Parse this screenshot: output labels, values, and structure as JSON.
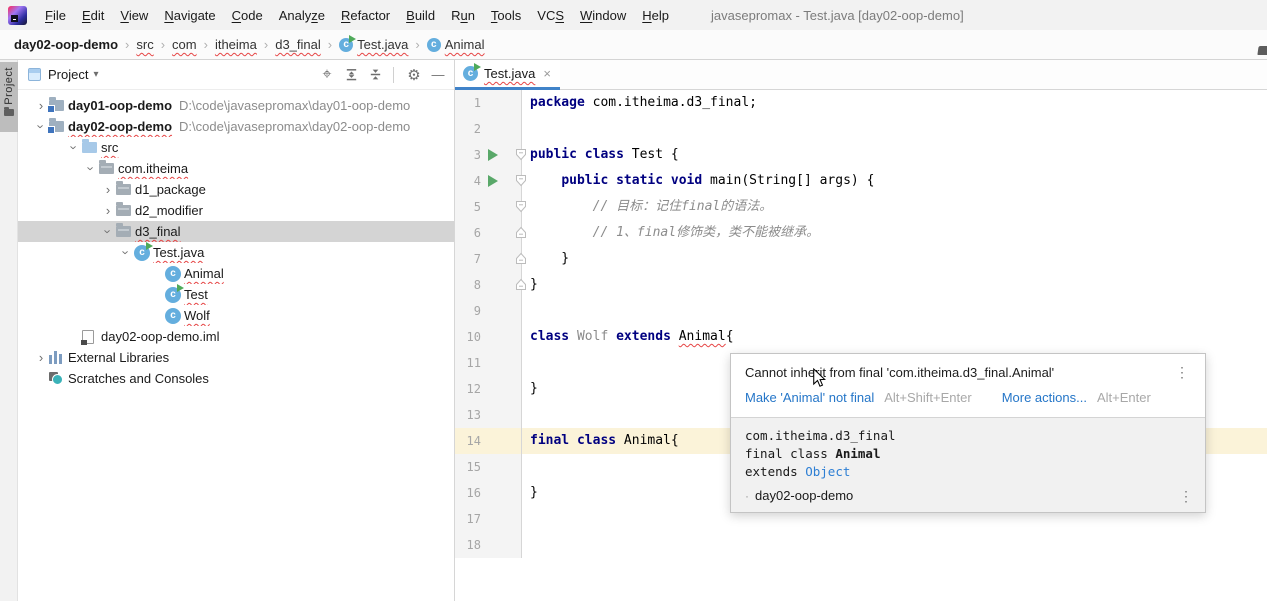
{
  "window": {
    "title": "javasepromax - Test.java [day02-oop-demo]"
  },
  "glyphs": {
    "chevron": "›",
    "caret": "▾",
    "close": "×",
    "kebab": "⋮",
    "sep": "›",
    "minus": "—",
    "dot": "·",
    "gear": "⚙",
    "locate": "⌖"
  },
  "colors": {
    "accent_blue": "#4083c9",
    "keyword": "#000080",
    "comment": "#8c8c8c",
    "error_red": "#e64545",
    "selection_gray": "#d4d4d4",
    "current_line": "#fbf3d9",
    "link_blue": "#2576c8",
    "run_green": "#59a869"
  },
  "menu": {
    "items": [
      {
        "label": "File",
        "mn": 0
      },
      {
        "label": "Edit",
        "mn": 0
      },
      {
        "label": "View",
        "mn": 0
      },
      {
        "label": "Navigate",
        "mn": 0
      },
      {
        "label": "Code",
        "mn": 0
      },
      {
        "label": "Analyze",
        "mn": 5
      },
      {
        "label": "Refactor",
        "mn": 0
      },
      {
        "label": "Build",
        "mn": 0
      },
      {
        "label": "Run",
        "mn": 1
      },
      {
        "label": "Tools",
        "mn": 0
      },
      {
        "label": "VCS",
        "mn": 2
      },
      {
        "label": "Window",
        "mn": 0
      },
      {
        "label": "Help",
        "mn": 0
      }
    ]
  },
  "breadcrumbs": {
    "project": "day02-oop-demo",
    "items": [
      {
        "label": "src",
        "typo": true
      },
      {
        "label": "com",
        "typo": true
      },
      {
        "label": "itheima",
        "typo": true
      },
      {
        "label": "d3_final",
        "typo": true
      },
      {
        "label": "Test.java",
        "icon": "class-run",
        "typo": true
      },
      {
        "label": "Animal",
        "icon": "class",
        "typo": true
      }
    ]
  },
  "project_panel": {
    "stripe_label": "Project",
    "title": "Project",
    "toolbar": [
      {
        "name": "locate"
      },
      {
        "name": "expand-all"
      },
      {
        "name": "collapse-all"
      },
      {
        "name": "settings"
      },
      {
        "name": "hide"
      }
    ],
    "tree": [
      {
        "label": "day01-oop-demo",
        "path": "D:\\code\\javasepromax\\day01-oop-demo",
        "level": 0,
        "icon": "proj",
        "chevron": "collapsed",
        "bold": true
      },
      {
        "label": "day02-oop-demo",
        "path": "D:\\code\\javasepromax\\day02-oop-demo",
        "level": 0,
        "icon": "proj",
        "chevron": "expanded",
        "bold": true,
        "typo": true
      },
      {
        "label": "src",
        "level": 1,
        "icon": "src",
        "chevron": "expanded",
        "typo": true
      },
      {
        "label": "com.itheima",
        "level": 2,
        "icon": "pkg",
        "chevron": "expanded",
        "typo": true
      },
      {
        "label": "d1_package",
        "level": 3,
        "icon": "pkg",
        "chevron": "collapsed"
      },
      {
        "label": "d2_modifier",
        "level": 3,
        "icon": "pkg",
        "chevron": "collapsed"
      },
      {
        "label": "d3_final",
        "level": 3,
        "icon": "pkg",
        "chevron": "expanded",
        "typo": true,
        "selected": true
      },
      {
        "label": "Test.java",
        "level": 4,
        "icon": "class-run",
        "chevron": "expanded",
        "typo": true
      },
      {
        "label": "Animal",
        "level": 5,
        "icon": "class",
        "typo": true
      },
      {
        "label": "Test",
        "level": 5,
        "icon": "class-run",
        "typo": true
      },
      {
        "label": "Wolf",
        "level": 5,
        "icon": "class",
        "typo": true
      },
      {
        "label": "day02-oop-demo.iml",
        "level": 1,
        "icon": "iml"
      },
      {
        "label": "External Libraries",
        "level": 0,
        "icon": "libs",
        "chevron": "collapsed"
      },
      {
        "label": "Scratches and Consoles",
        "level": 0,
        "icon": "scratch"
      }
    ]
  },
  "editor": {
    "tab": {
      "label": "Test.java",
      "icon": "class-run",
      "typo": true
    },
    "class_letter": "c",
    "current_line": 14,
    "lines": [
      {
        "n": 1,
        "tokens": [
          [
            "kw",
            "package"
          ],
          [
            "pl",
            " com.itheima.d3_final;"
          ]
        ]
      },
      {
        "n": 2,
        "tokens": []
      },
      {
        "n": 3,
        "run": true,
        "fold": "down",
        "tokens": [
          [
            "kw",
            "public class"
          ],
          [
            "pl",
            " Test {"
          ]
        ]
      },
      {
        "n": 4,
        "run": true,
        "fold": "down",
        "tokens": [
          [
            "pl",
            "    "
          ],
          [
            "kw",
            "public static void"
          ],
          [
            "pl",
            " main(String[] args) {"
          ]
        ]
      },
      {
        "n": 5,
        "fold": "down",
        "tokens": [
          [
            "pl",
            "        "
          ],
          [
            "cm",
            "// 目标：记住final的语法。"
          ]
        ]
      },
      {
        "n": 6,
        "fold": "up",
        "tokens": [
          [
            "pl",
            "        "
          ],
          [
            "cm",
            "// 1、final修饰类，类不能被继承。"
          ]
        ]
      },
      {
        "n": 7,
        "fold": "up",
        "tokens": [
          [
            "pl",
            "    }"
          ]
        ]
      },
      {
        "n": 8,
        "fold": "up",
        "tokens": [
          [
            "pl",
            "}"
          ]
        ]
      },
      {
        "n": 9,
        "tokens": []
      },
      {
        "n": 10,
        "tokens": [
          [
            "kw",
            "class"
          ],
          [
            "pl",
            " "
          ],
          [
            "un",
            "Wolf"
          ],
          [
            "pl",
            " "
          ],
          [
            "kw",
            "extends"
          ],
          [
            "pl",
            " "
          ],
          [
            "er",
            "Animal"
          ],
          [
            "pl",
            "{"
          ]
        ]
      },
      {
        "n": 11,
        "tokens": []
      },
      {
        "n": 12,
        "tokens": [
          [
            "pl",
            "}"
          ]
        ]
      },
      {
        "n": 13,
        "tokens": []
      },
      {
        "n": 14,
        "tokens": [
          [
            "kw",
            "final class"
          ],
          [
            "pl",
            " Animal{"
          ]
        ]
      },
      {
        "n": 15,
        "tokens": []
      },
      {
        "n": 16,
        "tokens": [
          [
            "pl",
            "}"
          ]
        ]
      },
      {
        "n": 17,
        "tokens": []
      },
      {
        "n": 18,
        "tokens": []
      }
    ]
  },
  "popup": {
    "error_text": "Cannot inherit from final 'com.itheima.d3_final.Animal'",
    "fix_label": "Make 'Animal' not final",
    "fix_shortcut": "Alt+Shift+Enter",
    "more_label": "More actions...",
    "more_shortcut": "Alt+Enter",
    "doc": {
      "package": "com.itheima.d3_final",
      "decl_prefix": "final class ",
      "decl_name": "Animal",
      "extends_prefix": "extends ",
      "extends_name": "Object",
      "module": "day02-oop-demo"
    }
  }
}
